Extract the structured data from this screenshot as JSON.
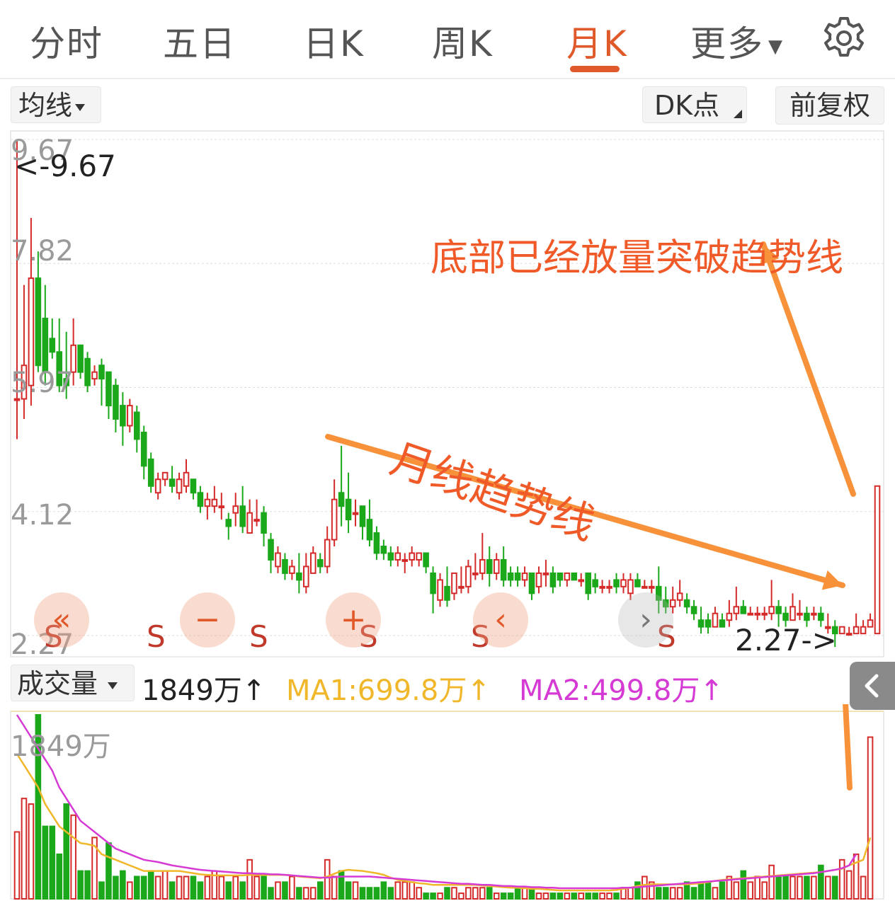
{
  "tabs": {
    "items": [
      {
        "label": "分时"
      },
      {
        "label": "五日"
      },
      {
        "label": "日K"
      },
      {
        "label": "周K"
      },
      {
        "label": "月K"
      },
      {
        "label": "更多"
      }
    ],
    "active": "月K"
  },
  "toolbar": {
    "ma_select": "均线",
    "dk_label": "DK点",
    "adjust_label": "前复权"
  },
  "price_axis": {
    "labels": [
      "9.67",
      "7.82",
      "5.97",
      "4.12",
      "2.27"
    ]
  },
  "markers": {
    "high_label": "<-9.67",
    "low_label": "2.27->",
    "s_labels": [
      "S",
      "S",
      "S",
      "S",
      "S",
      "S"
    ]
  },
  "controls": {
    "rewind": "«",
    "zoom_out": "−",
    "zoom_in": "+",
    "prev": "‹",
    "next": "›"
  },
  "annotations": {
    "breakout_text": "底部已经放量突破趋势线",
    "trendline_text": "月线趋势线"
  },
  "volume": {
    "selector_label": "成交量",
    "current": "1849万↑",
    "ma1": "MA1:699.8万↑",
    "ma2": "MA2:499.8万↑",
    "axis_top": "1849万"
  },
  "colors": {
    "up": "#d42a2a",
    "down": "#1ba81b",
    "accent": "#e0592a",
    "arrow": "#f7923a",
    "ma1": "#f1b72b",
    "ma2": "#d53ad5"
  },
  "chart_data": {
    "type": "candlestick",
    "price_axis": [
      2.27,
      4.12,
      5.97,
      7.82,
      9.67
    ],
    "volume_axis_max": "1849万",
    "candles": [
      {
        "o": 5.8,
        "h": 9.67,
        "c": 5.8,
        "l": 5.2
      },
      {
        "o": 5.8,
        "h": 7.5,
        "c": 6.3,
        "l": 5.5
      },
      {
        "o": 6.0,
        "h": 8.5,
        "c": 7.6,
        "l": 5.7
      },
      {
        "o": 7.6,
        "h": 8.0,
        "c": 6.3,
        "l": 6.2
      },
      {
        "o": 7.0,
        "h": 7.5,
        "c": 6.2,
        "l": 6.0
      },
      {
        "o": 6.7,
        "h": 7.0,
        "c": 6.5,
        "l": 6.4
      },
      {
        "o": 6.5,
        "h": 7.0,
        "c": 6.0,
        "l": 5.9
      },
      {
        "o": 6.1,
        "h": 6.8,
        "c": 6.0,
        "l": 5.8
      },
      {
        "o": 6.2,
        "h": 7.0,
        "c": 6.6,
        "l": 6.0
      },
      {
        "o": 6.6,
        "h": 6.6,
        "c": 6.2,
        "l": 6.1
      },
      {
        "o": 6.4,
        "h": 6.5,
        "c": 6.0,
        "l": 5.9
      },
      {
        "o": 6.1,
        "h": 6.3,
        "c": 6.2,
        "l": 6.0
      },
      {
        "o": 6.3,
        "h": 6.4,
        "c": 6.1,
        "l": 5.7
      },
      {
        "o": 6.2,
        "h": 6.2,
        "c": 5.7,
        "l": 5.5
      },
      {
        "o": 6.0,
        "h": 6.1,
        "c": 5.5,
        "l": 5.3
      },
      {
        "o": 5.7,
        "h": 5.9,
        "c": 5.4,
        "l": 5.1
      },
      {
        "o": 5.4,
        "h": 5.8,
        "c": 5.7,
        "l": 5.3
      },
      {
        "o": 5.6,
        "h": 5.7,
        "c": 5.2,
        "l": 5.0
      },
      {
        "o": 5.3,
        "h": 5.4,
        "c": 4.8,
        "l": 4.6
      },
      {
        "o": 4.9,
        "h": 5.0,
        "c": 4.5,
        "l": 4.4
      },
      {
        "o": 4.4,
        "h": 4.7,
        "c": 4.6,
        "l": 4.3
      },
      {
        "o": 4.6,
        "h": 4.7,
        "c": 4.7,
        "l": 4.5
      },
      {
        "o": 4.6,
        "h": 4.8,
        "c": 4.5,
        "l": 4.4
      },
      {
        "o": 4.4,
        "h": 4.7,
        "c": 4.6,
        "l": 4.3
      },
      {
        "o": 4.5,
        "h": 4.9,
        "c": 4.7,
        "l": 4.4
      },
      {
        "o": 4.6,
        "h": 4.6,
        "c": 4.4,
        "l": 4.3
      },
      {
        "o": 4.4,
        "h": 4.5,
        "c": 4.2,
        "l": 4.1
      },
      {
        "o": 4.2,
        "h": 4.4,
        "c": 4.3,
        "l": 4.0
      },
      {
        "o": 4.2,
        "h": 4.5,
        "c": 4.3,
        "l": 4.1
      },
      {
        "o": 4.2,
        "h": 4.4,
        "c": 4.2,
        "l": 4.0
      },
      {
        "o": 4.0,
        "h": 4.1,
        "c": 3.9,
        "l": 3.7
      },
      {
        "o": 4.1,
        "h": 4.4,
        "c": 4.2,
        "l": 3.9
      },
      {
        "o": 4.2,
        "h": 4.5,
        "c": 3.9,
        "l": 3.8
      },
      {
        "o": 3.8,
        "h": 4.3,
        "c": 4.1,
        "l": 3.8
      },
      {
        "o": 4.0,
        "h": 4.3,
        "c": 4.0,
        "l": 3.9
      },
      {
        "o": 4.1,
        "h": 4.2,
        "c": 3.8,
        "l": 3.6
      },
      {
        "o": 3.7,
        "h": 3.8,
        "c": 3.4,
        "l": 3.2
      },
      {
        "o": 3.3,
        "h": 3.6,
        "c": 3.5,
        "l": 3.2
      },
      {
        "o": 3.4,
        "h": 3.5,
        "c": 3.2,
        "l": 3.1
      },
      {
        "o": 3.2,
        "h": 3.4,
        "c": 3.3,
        "l": 3.1
      },
      {
        "o": 3.2,
        "h": 3.5,
        "c": 3.1,
        "l": 2.9
      },
      {
        "o": 3.0,
        "h": 3.5,
        "c": 3.3,
        "l": 2.9
      },
      {
        "o": 3.2,
        "h": 3.6,
        "c": 3.5,
        "l": 3.2
      },
      {
        "o": 3.4,
        "h": 3.5,
        "c": 3.3,
        "l": 3.2
      },
      {
        "o": 3.3,
        "h": 3.9,
        "c": 3.7,
        "l": 3.2
      },
      {
        "o": 3.7,
        "h": 4.6,
        "c": 4.3,
        "l": 3.6
      },
      {
        "o": 4.4,
        "h": 5.1,
        "c": 4.2,
        "l": 3.9
      },
      {
        "o": 4.3,
        "h": 4.7,
        "c": 4.0,
        "l": 3.8
      },
      {
        "o": 4.1,
        "h": 4.3,
        "c": 4.1,
        "l": 3.9
      },
      {
        "o": 4.2,
        "h": 4.2,
        "c": 3.9,
        "l": 3.7
      },
      {
        "o": 4.0,
        "h": 4.3,
        "c": 3.7,
        "l": 3.6
      },
      {
        "o": 3.8,
        "h": 3.9,
        "c": 3.5,
        "l": 3.4
      },
      {
        "o": 3.6,
        "h": 3.7,
        "c": 3.5,
        "l": 3.4
      },
      {
        "o": 3.5,
        "h": 3.6,
        "c": 3.4,
        "l": 3.3
      },
      {
        "o": 3.4,
        "h": 3.6,
        "c": 3.5,
        "l": 3.3
      },
      {
        "o": 3.4,
        "h": 3.5,
        "c": 3.4,
        "l": 3.2
      },
      {
        "o": 3.4,
        "h": 3.6,
        "c": 3.5,
        "l": 3.3
      },
      {
        "o": 3.4,
        "h": 3.5,
        "c": 3.5,
        "l": 3.3
      },
      {
        "o": 3.5,
        "h": 3.5,
        "c": 3.3,
        "l": 3.2
      },
      {
        "o": 3.2,
        "h": 3.3,
        "c": 2.9,
        "l": 2.6
      },
      {
        "o": 2.8,
        "h": 3.2,
        "c": 3.1,
        "l": 2.7
      },
      {
        "o": 3.0,
        "h": 3.3,
        "c": 2.8,
        "l": 2.7
      },
      {
        "o": 2.9,
        "h": 3.2,
        "c": 3.2,
        "l": 2.8
      },
      {
        "o": 3.0,
        "h": 3.3,
        "c": 3.0,
        "l": 2.9
      },
      {
        "o": 3.0,
        "h": 3.4,
        "c": 3.3,
        "l": 2.9
      },
      {
        "o": 3.2,
        "h": 3.5,
        "c": 3.2,
        "l": 3.1
      },
      {
        "o": 3.2,
        "h": 3.8,
        "c": 3.4,
        "l": 3.1
      },
      {
        "o": 3.4,
        "h": 3.6,
        "c": 3.2,
        "l": 3.0
      },
      {
        "o": 3.2,
        "h": 3.5,
        "c": 3.4,
        "l": 3.1
      },
      {
        "o": 3.4,
        "h": 3.6,
        "c": 3.1,
        "l": 3.0
      },
      {
        "o": 3.2,
        "h": 3.3,
        "c": 3.1,
        "l": 3.0
      },
      {
        "o": 3.2,
        "h": 3.3,
        "c": 3.1,
        "l": 3.0
      },
      {
        "o": 3.1,
        "h": 3.3,
        "c": 3.2,
        "l": 3.0
      },
      {
        "o": 3.2,
        "h": 3.2,
        "c": 2.9,
        "l": 2.8
      },
      {
        "o": 3.0,
        "h": 3.3,
        "c": 3.2,
        "l": 2.9
      },
      {
        "o": 3.2,
        "h": 3.4,
        "c": 3.2,
        "l": 3.0
      },
      {
        "o": 3.2,
        "h": 3.3,
        "c": 3.0,
        "l": 2.9
      },
      {
        "o": 3.2,
        "h": 3.2,
        "c": 3.1,
        "l": 3.0
      },
      {
        "o": 3.1,
        "h": 3.2,
        "c": 3.2,
        "l": 3.0
      },
      {
        "o": 3.2,
        "h": 3.2,
        "c": 3.1,
        "l": 3.1
      },
      {
        "o": 3.1,
        "h": 3.2,
        "c": 3.1,
        "l": 3.0
      },
      {
        "o": 3.2,
        "h": 3.2,
        "c": 2.9,
        "l": 2.8
      },
      {
        "o": 3.1,
        "h": 3.2,
        "c": 3.0,
        "l": 2.9
      },
      {
        "o": 3.0,
        "h": 3.1,
        "c": 3.0,
        "l": 2.9
      },
      {
        "o": 3.0,
        "h": 3.1,
        "c": 3.0,
        "l": 2.9
      },
      {
        "o": 3.1,
        "h": 3.2,
        "c": 3.0,
        "l": 2.9
      },
      {
        "o": 3.0,
        "h": 3.2,
        "c": 3.1,
        "l": 2.9
      },
      {
        "o": 2.9,
        "h": 3.2,
        "c": 3.1,
        "l": 2.8
      },
      {
        "o": 3.1,
        "h": 3.2,
        "c": 3.0,
        "l": 3.0
      },
      {
        "o": 3.0,
        "h": 3.1,
        "c": 3.0,
        "l": 3.0
      },
      {
        "o": 3.0,
        "h": 3.1,
        "c": 3.0,
        "l": 2.9
      },
      {
        "o": 3.0,
        "h": 3.3,
        "c": 2.8,
        "l": 2.6
      },
      {
        "o": 2.8,
        "h": 3.0,
        "c": 2.7,
        "l": 2.6
      },
      {
        "o": 2.7,
        "h": 3.0,
        "c": 2.8,
        "l": 2.6
      },
      {
        "o": 2.8,
        "h": 3.1,
        "c": 2.9,
        "l": 2.7
      },
      {
        "o": 2.8,
        "h": 2.9,
        "c": 2.7,
        "l": 2.6
      },
      {
        "o": 2.7,
        "h": 2.8,
        "c": 2.6,
        "l": 2.5
      },
      {
        "o": 2.5,
        "h": 2.7,
        "c": 2.4,
        "l": 2.3
      },
      {
        "o": 2.5,
        "h": 2.6,
        "c": 2.4,
        "l": 2.3
      },
      {
        "o": 2.4,
        "h": 2.7,
        "c": 2.6,
        "l": 2.4
      },
      {
        "o": 2.5,
        "h": 2.6,
        "c": 2.4,
        "l": 2.4
      },
      {
        "o": 2.5,
        "h": 2.8,
        "c": 2.6,
        "l": 2.4
      },
      {
        "o": 2.6,
        "h": 3.0,
        "c": 2.7,
        "l": 2.5
      },
      {
        "o": 2.7,
        "h": 2.8,
        "c": 2.6,
        "l": 2.6
      },
      {
        "o": 2.6,
        "h": 2.7,
        "c": 2.6,
        "l": 2.6
      },
      {
        "o": 2.6,
        "h": 2.7,
        "c": 2.6,
        "l": 2.5
      },
      {
        "o": 2.6,
        "h": 2.7,
        "c": 2.6,
        "l": 2.5
      },
      {
        "o": 2.6,
        "h": 3.1,
        "c": 2.7,
        "l": 2.5
      },
      {
        "o": 2.7,
        "h": 2.8,
        "c": 2.6,
        "l": 2.4
      },
      {
        "o": 2.6,
        "h": 2.7,
        "c": 2.5,
        "l": 2.4
      },
      {
        "o": 2.5,
        "h": 2.9,
        "c": 2.7,
        "l": 2.5
      },
      {
        "o": 2.6,
        "h": 2.8,
        "c": 2.6,
        "l": 2.5
      },
      {
        "o": 2.6,
        "h": 2.7,
        "c": 2.5,
        "l": 2.4
      },
      {
        "o": 2.6,
        "h": 2.7,
        "c": 2.6,
        "l": 2.5
      },
      {
        "o": 2.6,
        "h": 2.7,
        "c": 2.5,
        "l": 2.4
      },
      {
        "o": 2.4,
        "h": 2.6,
        "c": 2.4,
        "l": 2.3
      },
      {
        "o": 2.4,
        "h": 2.5,
        "c": 2.3,
        "l": 2.1
      },
      {
        "o": 2.3,
        "h": 2.4,
        "c": 2.4,
        "l": 2.3
      },
      {
        "o": 2.3,
        "h": 2.4,
        "c": 2.3,
        "l": 2.3
      },
      {
        "o": 2.3,
        "h": 2.6,
        "c": 2.4,
        "l": 2.3
      },
      {
        "o": 2.3,
        "h": 2.5,
        "c": 2.4,
        "l": 2.3
      },
      {
        "o": 2.4,
        "h": 2.6,
        "c": 2.5,
        "l": 2.4
      },
      {
        "o": 2.3,
        "h": 4.5,
        "c": 4.5,
        "l": 2.3
      }
    ],
    "volume": [
      12,
      18,
      17,
      33,
      13,
      13,
      8,
      17,
      15,
      5,
      5,
      11,
      3,
      10,
      4,
      5,
      3,
      4,
      4,
      5,
      4,
      5,
      3,
      4,
      4,
      4,
      3,
      4,
      5,
      4,
      3,
      4,
      3,
      7,
      4,
      4,
      2,
      3,
      3,
      4,
      2,
      2,
      2,
      3,
      7,
      4,
      5,
      3,
      3,
      2,
      2,
      2,
      3,
      2,
      3,
      3,
      3,
      2,
      1,
      1,
      1,
      2,
      2,
      1,
      2,
      2,
      2,
      2,
      1,
      1,
      1,
      2,
      2,
      2,
      1,
      1,
      1,
      1,
      1,
      1,
      1,
      1,
      1,
      1,
      1,
      1,
      2,
      2,
      3,
      4,
      3,
      2,
      2,
      2,
      2,
      3,
      2,
      3,
      3,
      2,
      3,
      4,
      3,
      5,
      3,
      4,
      3,
      6,
      4,
      4,
      4,
      4,
      4,
      4,
      6,
      4,
      4,
      7,
      5,
      8,
      4,
      29
    ],
    "ma1_line": [
      26,
      24,
      22,
      20,
      17,
      15,
      13,
      12,
      11,
      10,
      9.8,
      9.5,
      8,
      7.5,
      7,
      6.5,
      6,
      5.5,
      5,
      5,
      5,
      5,
      5,
      5,
      4.8,
      4.6,
      4.4,
      4.3,
      4.2,
      4.2,
      4.2,
      4.2,
      4.2,
      4.3,
      4.3,
      4.3,
      4.3,
      4.3,
      4.3,
      4.2,
      4,
      3.9,
      3.8,
      3.7,
      4,
      4.5,
      5,
      5.2,
      5.1,
      5,
      4.8,
      4.6,
      4.3,
      3.8,
      3.4,
      3.2,
      3,
      2.8,
      2.7,
      2.5,
      2.5,
      2.5,
      2.5,
      2.5,
      2.5,
      2.5,
      2.4,
      2.3,
      2.2,
      2.1,
      2,
      2,
      1.9,
      1.8,
      1.8,
      1.7,
      1.6,
      1.5,
      1.5,
      1.5,
      1.5,
      1.5,
      1.5,
      1.5,
      1.5,
      1.6,
      1.8,
      2,
      2.3,
      2.5,
      2.6,
      2.6,
      2.6,
      2.6,
      2.6,
      2.6,
      2.7,
      2.8,
      3,
      3.2,
      3.4,
      3.5,
      3.6,
      3.7,
      3.8,
      3.9,
      4,
      4.1,
      4.2,
      4.3,
      4.4,
      4.5,
      4.6,
      4.7,
      4.8,
      5,
      5.2,
      5.4,
      6,
      6.5,
      7,
      11
    ],
    "ma2_line": [
      33,
      31,
      29,
      27,
      25,
      23,
      20,
      18,
      16,
      14,
      13,
      12,
      11,
      10,
      9,
      8.5,
      8,
      7.5,
      7,
      6.8,
      6.6,
      6.3,
      6,
      5.8,
      5.6,
      5.4,
      5.2,
      5.1,
      5,
      4.9,
      4.8,
      4.7,
      4.6,
      4.6,
      4.5,
      4.5,
      4.4,
      4.4,
      4.3,
      4.2,
      4.1,
      4,
      3.9,
      3.8,
      3.8,
      3.9,
      4,
      4,
      4,
      4,
      4,
      3.9,
      3.8,
      3.7,
      3.6,
      3.5,
      3.4,
      3.3,
      3.2,
      3.1,
      3,
      2.9,
      2.8,
      2.7,
      2.7,
      2.6,
      2.5,
      2.5,
      2.4,
      2.3,
      2.3,
      2.2,
      2.2,
      2.1,
      2.1,
      2,
      2,
      1.9,
      1.9,
      1.9,
      1.9,
      1.9,
      1.9,
      1.9,
      1.9,
      1.9,
      2,
      2,
      2.1,
      2.2,
      2.3,
      2.4,
      2.5,
      2.6,
      2.7,
      2.8,
      2.9,
      3,
      3.1,
      3.2,
      3.3,
      3.4,
      3.5,
      3.6,
      3.7,
      3.8,
      3.9,
      4,
      4.1,
      4.2,
      4.3,
      4.4,
      4.5,
      4.6,
      4.8,
      5,
      5.2,
      5.5,
      6,
      8
    ]
  }
}
